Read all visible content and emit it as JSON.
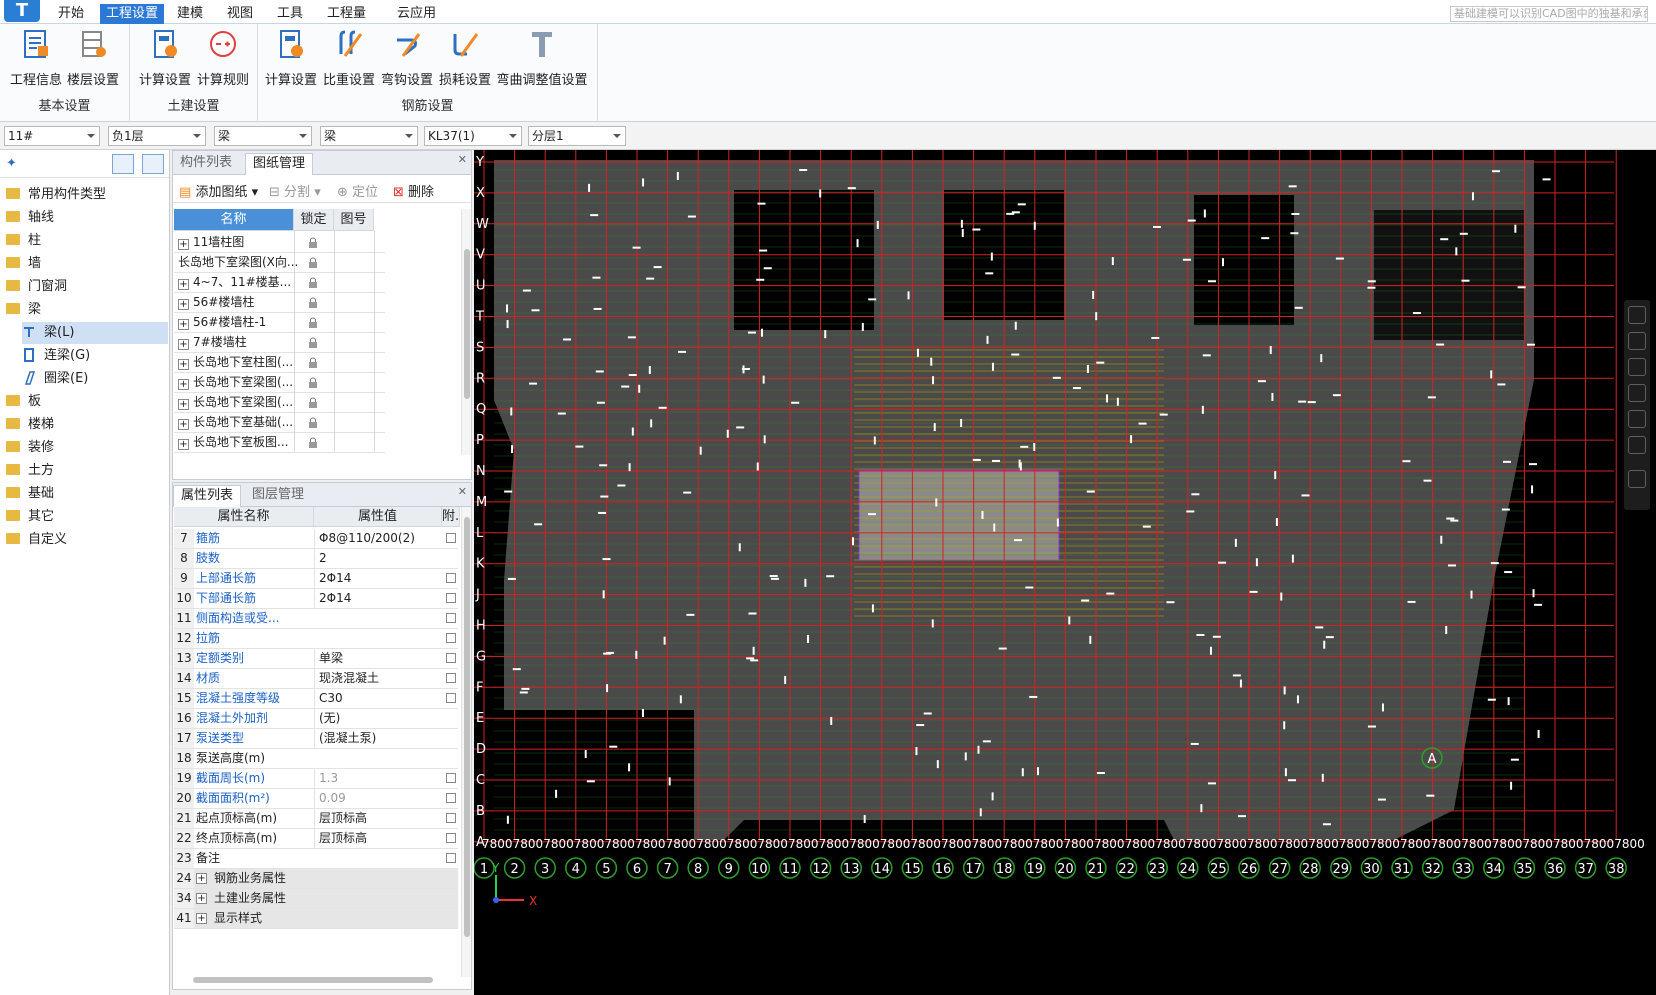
{
  "app": {
    "logo_text": "T",
    "search_hint": "基础建模可以识别CAD图中的独基和承台"
  },
  "menu": [
    "开始",
    "工程设置",
    "建模",
    "视图",
    "工具",
    "工程量",
    "云应用"
  ],
  "ribbon": {
    "groups": [
      {
        "label": "基本设置",
        "buttons": [
          "工程信息",
          "楼层设置"
        ]
      },
      {
        "label": "土建设置",
        "buttons": [
          "计算设置",
          "计算规则"
        ]
      },
      {
        "label": "钢筋设置",
        "buttons": [
          "计算设置",
          "比重设置",
          "弯钩设置",
          "损耗设置",
          "弯曲调整值设置"
        ]
      }
    ]
  },
  "selectors": [
    "11#",
    "负1层",
    "梁",
    "梁",
    "KL37(1)",
    "分层1"
  ],
  "tree": {
    "items": [
      {
        "label": "常用构件类型"
      },
      {
        "label": "轴线"
      },
      {
        "label": "柱"
      },
      {
        "label": "墙"
      },
      {
        "label": "门窗洞"
      },
      {
        "label": "梁"
      },
      {
        "label": "梁(L)",
        "sub": true,
        "selected": true
      },
      {
        "label": "连梁(G)",
        "sub": true
      },
      {
        "label": "圈梁(E)",
        "sub": true
      },
      {
        "label": "板"
      },
      {
        "label": "楼梯"
      },
      {
        "label": "装修"
      },
      {
        "label": "土方"
      },
      {
        "label": "基础"
      },
      {
        "label": "其它"
      },
      {
        "label": "自定义"
      }
    ]
  },
  "drawings_panel": {
    "tabs": [
      "构件列表",
      "图纸管理"
    ],
    "active_tab": 1,
    "toolbar": {
      "add": "添加图纸",
      "split": "分割",
      "locate": "定位",
      "delete": "删除"
    },
    "columns": [
      "名称",
      "锁定",
      "图号"
    ],
    "rows": [
      {
        "name": "11墙柱图",
        "plus": true
      },
      {
        "name": "长岛地下室梁图(X向...",
        "plus": false
      },
      {
        "name": "4~7、11#楼基...",
        "plus": true
      },
      {
        "name": "56#楼墙柱",
        "plus": true
      },
      {
        "name": "56#楼墙柱-1",
        "plus": true
      },
      {
        "name": "7#楼墙柱",
        "plus": true
      },
      {
        "name": "长岛地下室柱图(...",
        "plus": true
      },
      {
        "name": "长岛地下室梁图(...",
        "plus": true
      },
      {
        "name": "长岛地下室梁图(...",
        "plus": true
      },
      {
        "name": "长岛地下室基础(...",
        "plus": true
      },
      {
        "name": "长岛地下室板图...",
        "plus": true
      }
    ]
  },
  "props_panel": {
    "tabs": [
      "属性列表",
      "图层管理"
    ],
    "active_tab": 0,
    "columns": [
      "属性名称",
      "属性值",
      "附."
    ],
    "rows": [
      {
        "num": "7",
        "name": "箍筋",
        "value": "Φ8@110/200(2)",
        "blue": true,
        "chk": true
      },
      {
        "num": "8",
        "name": "肢数",
        "value": "2",
        "blue": true,
        "chk": false
      },
      {
        "num": "9",
        "name": "上部通长筋",
        "value": "2Φ14",
        "blue": true,
        "chk": true
      },
      {
        "num": "10",
        "name": "下部通长筋",
        "value": "2Φ14",
        "blue": true,
        "chk": true
      },
      {
        "num": "11",
        "name": "侧面构造或受...",
        "value": "",
        "blue": true,
        "chk": true
      },
      {
        "num": "12",
        "name": "拉筋",
        "value": "",
        "blue": true,
        "chk": true
      },
      {
        "num": "13",
        "name": "定额类别",
        "value": "单梁",
        "blue": true,
        "chk": true
      },
      {
        "num": "14",
        "name": "材质",
        "value": "现浇混凝土",
        "blue": true,
        "chk": true
      },
      {
        "num": "15",
        "name": "混凝土强度等级",
        "value": "C30",
        "blue": true,
        "chk": true
      },
      {
        "num": "16",
        "name": "混凝土外加剂",
        "value": "(无)",
        "blue": true,
        "chk": false
      },
      {
        "num": "17",
        "name": "泵送类型",
        "value": "(混凝土泵)",
        "blue": true,
        "chk": false
      },
      {
        "num": "18",
        "name": "泵送高度(m)",
        "value": "",
        "blue": false,
        "chk": false
      },
      {
        "num": "19",
        "name": "截面周长(m)",
        "value": "1.3",
        "blue": true,
        "chk": true,
        "gray": true
      },
      {
        "num": "20",
        "name": "截面面积(m²)",
        "value": "0.09",
        "blue": true,
        "chk": true,
        "gray": true
      },
      {
        "num": "21",
        "name": "起点顶标高(m)",
        "value": "层顶标高",
        "blue": false,
        "chk": true
      },
      {
        "num": "22",
        "name": "终点顶标高(m)",
        "value": "层顶标高",
        "blue": false,
        "chk": true
      },
      {
        "num": "23",
        "name": "备注",
        "value": "",
        "blue": false,
        "chk": true
      },
      {
        "num": "24",
        "name": "钢筋业务属性",
        "value": "",
        "group": true
      },
      {
        "num": "34",
        "name": "土建业务属性",
        "value": "",
        "group": true
      },
      {
        "num": "41",
        "name": "显示样式",
        "value": "",
        "group": true
      }
    ]
  },
  "canvas": {
    "row_labels": [
      "Y",
      "X",
      "W",
      "V",
      "U",
      "T",
      "S",
      "R",
      "Q",
      "P",
      "N",
      "M",
      "L",
      "K",
      "J",
      "H",
      "G",
      "F",
      "E",
      "D",
      "C",
      "B",
      "A"
    ],
    "col_numbers": [
      "1",
      "2",
      "3",
      "4",
      "5",
      "6",
      "7",
      "8",
      "9",
      "10",
      "11",
      "12",
      "13",
      "14",
      "15",
      "16",
      "17",
      "18",
      "19",
      "20",
      "21",
      "22",
      "23",
      "24",
      "25",
      "26",
      "27",
      "28",
      "29",
      "30",
      "31",
      "32",
      "33",
      "34",
      "35",
      "36",
      "37",
      "38"
    ],
    "dim_text": "7800",
    "axis_mark_A": "A",
    "ucs_x": "X",
    "ucs_y": "Y",
    "colors": {
      "grid": "#d42222",
      "fill": "#4a4a4a",
      "beam": "#2aa02a",
      "yellow": "#c8a000",
      "white": "#ffffff"
    }
  }
}
